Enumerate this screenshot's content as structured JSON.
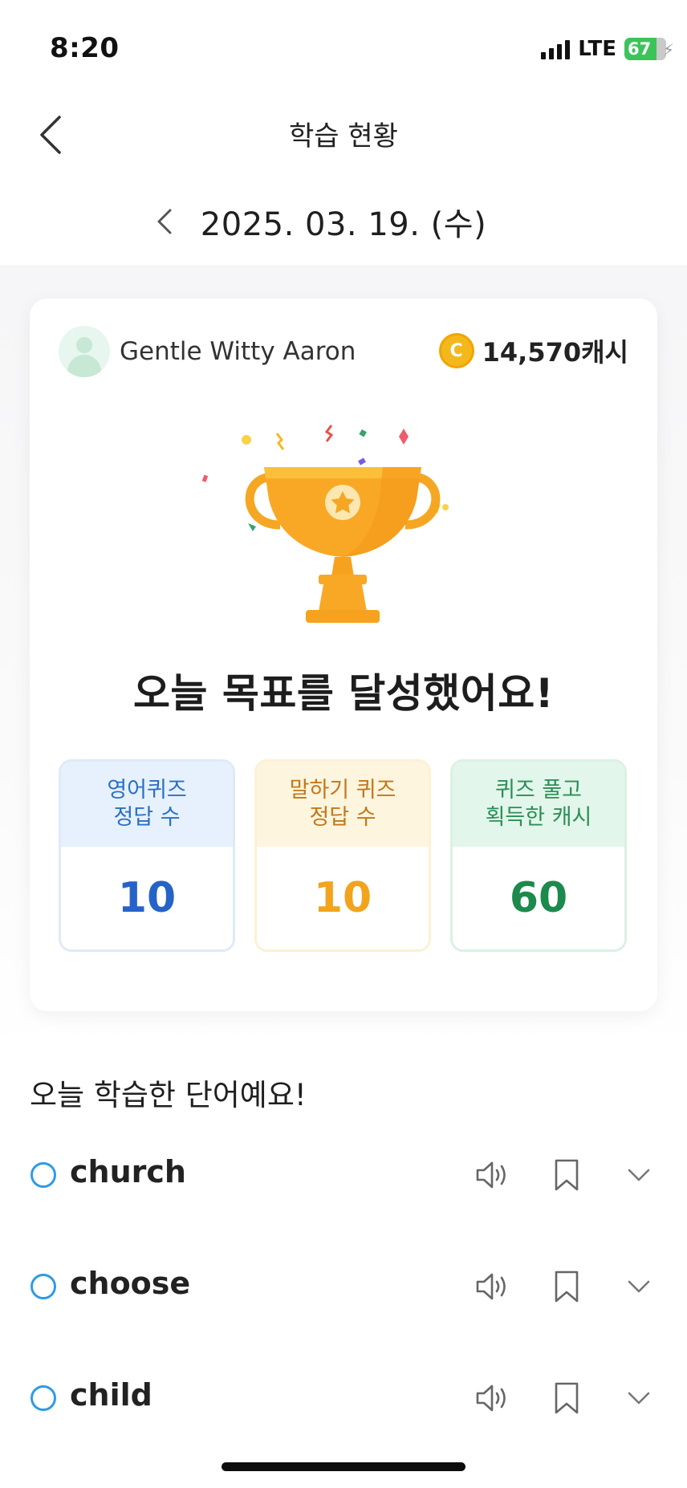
{
  "status_bar": {
    "time": "8:20",
    "network": "LTE",
    "battery": "67"
  },
  "header": {
    "title": "학습 현황",
    "back_icon": "chevron-left-icon"
  },
  "date_nav": {
    "date": "2025. 03. 19. (수)",
    "prev_icon": "chevron-left-icon"
  },
  "profile": {
    "name": "Gentle Witty Aaron",
    "cash": "14,570캐시",
    "coin_symbol": "C"
  },
  "trophy_icon": "trophy-icon",
  "goal_message": "오늘 목표를 달성했어요!",
  "stats": [
    {
      "label_line1": "영어퀴즈",
      "label_line2": "정답 수",
      "value": "10",
      "color": "#2563c7"
    },
    {
      "label_line1": "말하기 퀴즈",
      "label_line2": "정답 수",
      "value": "10",
      "color": "#f1a41c"
    },
    {
      "label_line1": "퀴즈 풀고",
      "label_line2": "획득한 캐시",
      "value": "60",
      "color": "#1b8a4c"
    }
  ],
  "words_title": "오늘 학습한 단어예요!",
  "words": [
    {
      "word": "church"
    },
    {
      "word": "choose"
    },
    {
      "word": "child"
    }
  ],
  "word_icons": {
    "speaker": "speaker-icon",
    "bookmark": "bookmark-icon",
    "expand": "chevron-down-icon"
  },
  "colors": {
    "accent_blue": "#2e9be5",
    "coin": "#f5b81c",
    "trophy": "#f9a825"
  }
}
